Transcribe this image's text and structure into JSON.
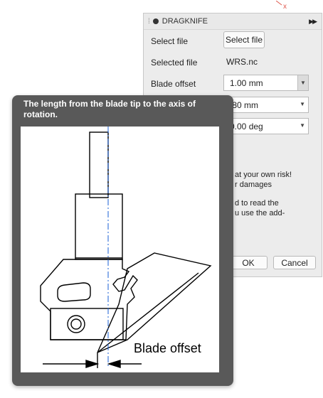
{
  "window": {
    "close_mark": "x"
  },
  "panel": {
    "title": "DRAGKNIFE",
    "select_file_label": "Select file",
    "select_file_button": "Select file",
    "selected_file_label": "Selected file",
    "selected_file_value": "WRS.nc",
    "blade_offset_label": "Blade offset",
    "blade_offset_value": "1.00 mm",
    "second_value": ".80 mm",
    "third_value": "0.00 deg",
    "warning_line1": "at your own risk!",
    "warning_line2": "r damages",
    "warning_line3": "d to read the",
    "warning_line4": "u use the add-",
    "ok_button": "OK",
    "cancel_button": "Cancel"
  },
  "tooltip": {
    "text": "The length from the blade tip to the axis of rotation.",
    "image_label": "Blade offset"
  },
  "colors": {
    "axis_line": "#1a5fd6",
    "tooltip_bg": "#595959",
    "panel_bg": "#ececec"
  }
}
